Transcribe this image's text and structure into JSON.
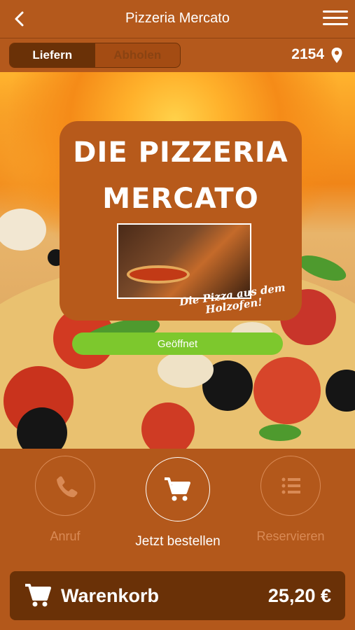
{
  "header": {
    "title": "Pizzeria Mercato"
  },
  "order_mode": {
    "deliver_label": "Liefern",
    "pickup_label": "Abholen",
    "selected": "Liefern"
  },
  "location": {
    "postal_code": "2154"
  },
  "logo": {
    "line1": "DIE PIZZERIA",
    "line2": "MERCATO",
    "tagline": "Die Pizza aus dem Holzofen!"
  },
  "status": {
    "label": "Geöffnet"
  },
  "actions": {
    "call_label": "Anruf",
    "order_label": "Jetzt bestellen",
    "reserve_label": "Reservieren"
  },
  "cart": {
    "label": "Warenkorb",
    "total": "25,20 €"
  },
  "colors": {
    "primary": "#b4591c",
    "dark": "#6a3107",
    "open": "#7dc82d"
  }
}
